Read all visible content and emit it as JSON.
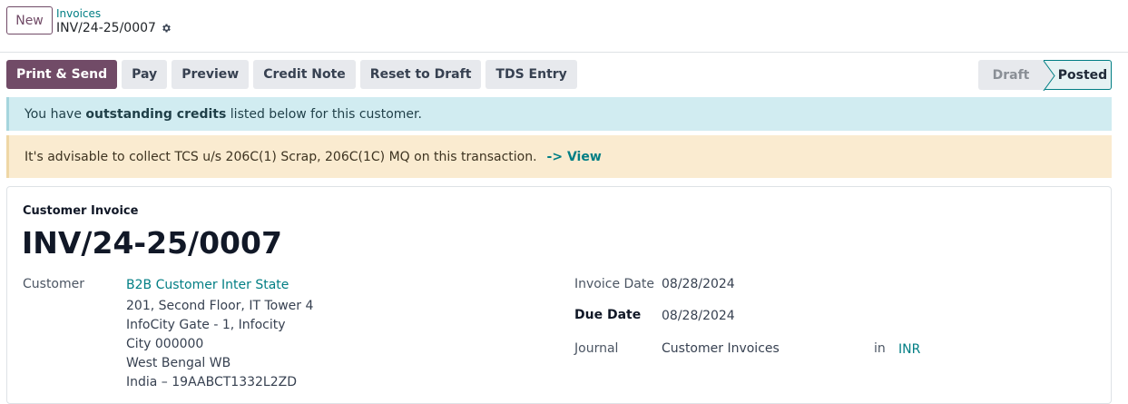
{
  "header": {
    "new_label": "New",
    "breadcrumb": "Invoices",
    "record_name": "INV/24-25/0007"
  },
  "actions": [
    {
      "label": "Print & Send",
      "primary": true
    },
    {
      "label": "Pay"
    },
    {
      "label": "Preview"
    },
    {
      "label": "Credit Note"
    },
    {
      "label": "Reset to Draft"
    },
    {
      "label": "TDS Entry"
    }
  ],
  "status": {
    "draft": "Draft",
    "posted": "Posted",
    "current": "Posted"
  },
  "alerts": {
    "info_prefix": "You have ",
    "info_bold": "outstanding credits",
    "info_suffix": " listed below for this customer.",
    "warning_text": "It's advisable to collect TCS u/s 206C(1) Scrap, 206C(1C) MQ on this transaction.",
    "warning_link": "-> View"
  },
  "form": {
    "doc_type": "Customer Invoice",
    "doc_name": "INV/24-25/0007",
    "customer_label": "Customer",
    "customer_name": "B2B Customer Inter State",
    "address": [
      "201, Second Floor, IT Tower 4",
      "InfoCity Gate - 1, Infocity",
      "City 000000",
      "West Bengal WB",
      "India – 19AABCT1332L2ZD"
    ],
    "invoice_date_label": "Invoice Date",
    "invoice_date": "08/28/2024",
    "due_date_label": "Due Date",
    "due_date": "08/28/2024",
    "journal_label": "Journal",
    "journal": "Customer Invoices",
    "in_label": "in",
    "currency": "INR"
  },
  "colors": {
    "brand": "#714b67",
    "link": "#017e84",
    "info_bg": "#d1ecf1",
    "warning_bg": "#faebd0"
  }
}
